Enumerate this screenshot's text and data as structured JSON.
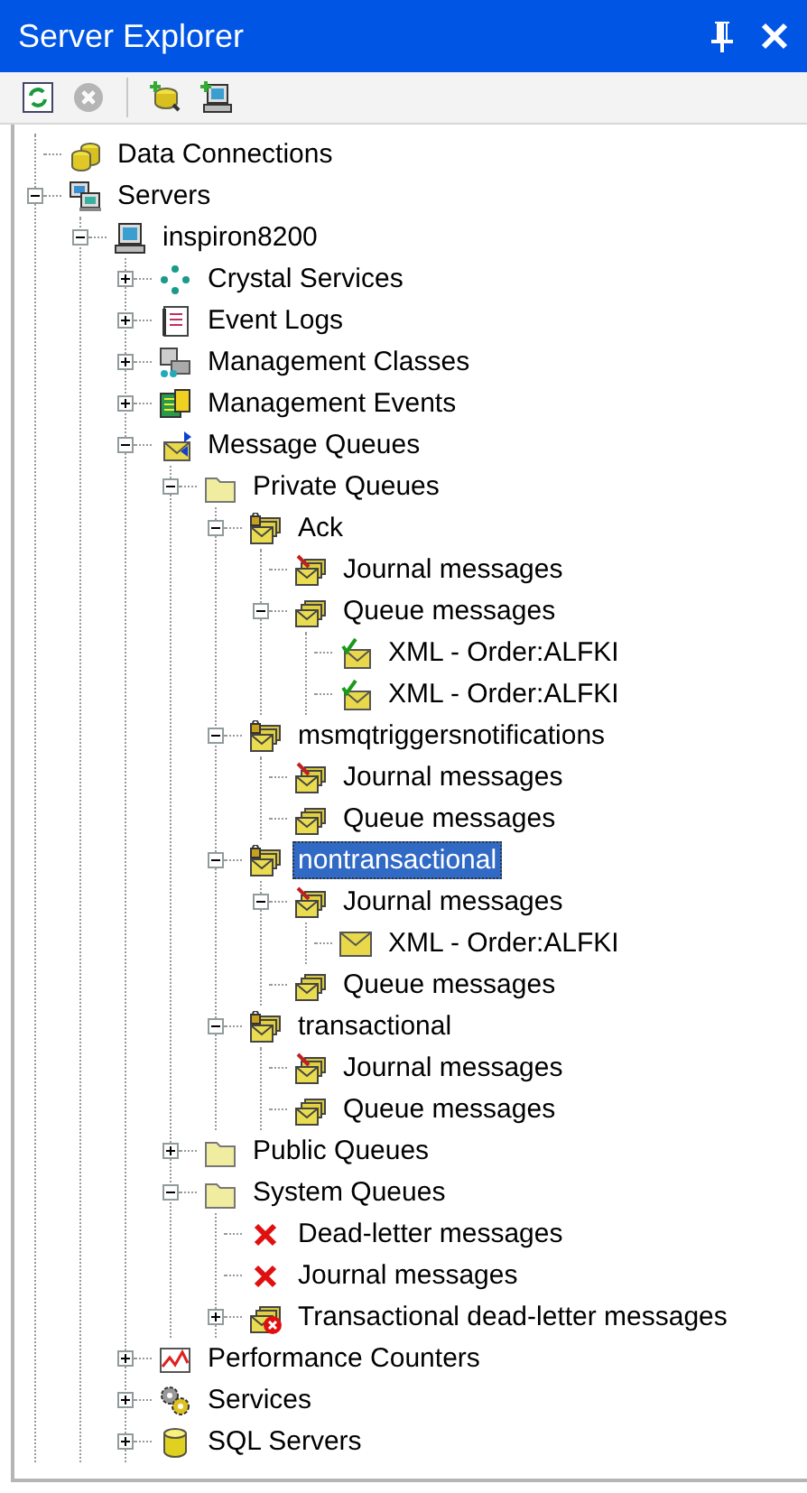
{
  "window": {
    "title": "Server Explorer"
  },
  "toolbar": [
    {
      "kind": "refresh",
      "disabled": false
    },
    {
      "kind": "stop",
      "disabled": true
    },
    {
      "kind": "separator"
    },
    {
      "kind": "add-connection",
      "disabled": false
    },
    {
      "kind": "add-server",
      "disabled": false
    }
  ],
  "tree": [
    {
      "label": "Data Connections",
      "kind": "database",
      "selected": false
    },
    {
      "label": "Servers",
      "kind": "servers",
      "selected": false,
      "expanded": true,
      "children": [
        {
          "label": "inspiron8200",
          "kind": "computer",
          "selected": false,
          "expanded": true,
          "children": [
            {
              "label": "Crystal Services",
              "kind": "crystal",
              "selected": false,
              "expanded": false
            },
            {
              "label": "Event Logs",
              "kind": "eventlog",
              "selected": false,
              "expanded": false
            },
            {
              "label": "Management Classes",
              "kind": "classes",
              "selected": false,
              "expanded": false
            },
            {
              "label": "Management Events",
              "kind": "events",
              "selected": false,
              "expanded": false
            },
            {
              "label": "Message Queues",
              "kind": "msmq",
              "selected": false,
              "expanded": true,
              "children": [
                {
                  "label": "Private Queues",
                  "kind": "folder",
                  "selected": false,
                  "expanded": true,
                  "children": [
                    {
                      "label": "Ack",
                      "kind": "queue-locked",
                      "selected": false,
                      "expanded": true,
                      "children": [
                        {
                          "label": "Journal messages",
                          "kind": "journal",
                          "selected": false
                        },
                        {
                          "label": "Queue messages",
                          "kind": "queue",
                          "selected": false,
                          "expanded": true,
                          "children": [
                            {
                              "label": "XML - Order:ALFKI",
                              "kind": "message-ok",
                              "selected": false
                            },
                            {
                              "label": "XML - Order:ALFKI",
                              "kind": "message-ok",
                              "selected": false
                            }
                          ]
                        }
                      ]
                    },
                    {
                      "label": "msmqtriggersnotifications",
                      "kind": "queue-locked",
                      "selected": false,
                      "expanded": true,
                      "children": [
                        {
                          "label": "Journal messages",
                          "kind": "journal",
                          "selected": false
                        },
                        {
                          "label": "Queue messages",
                          "kind": "queue",
                          "selected": false
                        }
                      ]
                    },
                    {
                      "label": "nontransactional",
                      "kind": "queue-locked",
                      "selected": true,
                      "expanded": true,
                      "children": [
                        {
                          "label": "Journal messages",
                          "kind": "journal",
                          "selected": false,
                          "expanded": true,
                          "children": [
                            {
                              "label": "XML - Order:ALFKI",
                              "kind": "message",
                              "selected": false
                            }
                          ]
                        },
                        {
                          "label": "Queue messages",
                          "kind": "queue",
                          "selected": false
                        }
                      ]
                    },
                    {
                      "label": "transactional",
                      "kind": "queue-locked",
                      "selected": false,
                      "expanded": true,
                      "children": [
                        {
                          "label": "Journal messages",
                          "kind": "journal",
                          "selected": false
                        },
                        {
                          "label": "Queue messages",
                          "kind": "queue",
                          "selected": false
                        }
                      ]
                    }
                  ]
                },
                {
                  "label": "Public Queues",
                  "kind": "folder",
                  "selected": false,
                  "expanded": false
                },
                {
                  "label": "System Queues",
                  "kind": "folder",
                  "selected": false,
                  "expanded": true,
                  "children": [
                    {
                      "label": "Dead-letter messages",
                      "kind": "error",
                      "selected": false
                    },
                    {
                      "label": "Journal messages",
                      "kind": "error",
                      "selected": false
                    },
                    {
                      "label": "Transactional dead-letter messages",
                      "kind": "queue-error",
                      "selected": false,
                      "expanded": false
                    }
                  ]
                }
              ]
            },
            {
              "label": "Performance Counters",
              "kind": "chart",
              "selected": false,
              "expanded": false
            },
            {
              "label": "Services",
              "kind": "services",
              "selected": false,
              "expanded": false
            },
            {
              "label": "SQL Servers",
              "kind": "sql",
              "selected": false,
              "expanded": false
            }
          ]
        }
      ]
    }
  ]
}
